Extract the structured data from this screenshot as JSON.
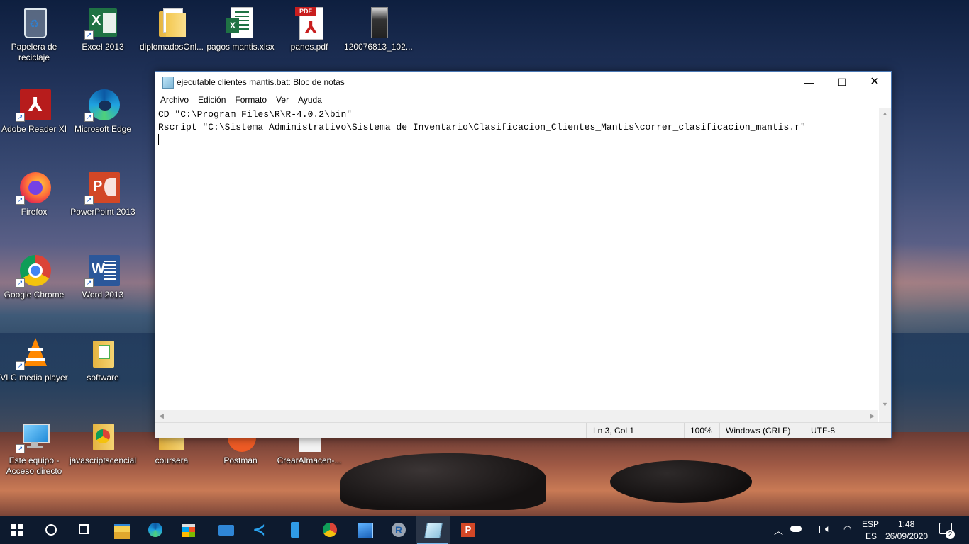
{
  "desktop": {
    "icons": [
      {
        "label": "Papelera de reciclaje",
        "icon": "recycle-bin-icon"
      },
      {
        "label": "Excel 2013",
        "icon": "excel-icon"
      },
      {
        "label": "diplomadosOnl...",
        "icon": "folder-icon"
      },
      {
        "label": "pagos mantis.xlsx",
        "icon": "excel-file-icon"
      },
      {
        "label": "panes.pdf",
        "icon": "pdf-file-icon"
      },
      {
        "label": "120076813_102...",
        "icon": "photo-file-icon"
      },
      {
        "label": "Adobe Reader XI",
        "icon": "adobe-reader-icon"
      },
      {
        "label": "Microsoft Edge",
        "icon": "edge-icon"
      },
      {
        "label": "Firefox",
        "icon": "firefox-icon"
      },
      {
        "label": "PowerPoint 2013",
        "icon": "powerpoint-icon"
      },
      {
        "label": "Google Chrome",
        "icon": "chrome-icon"
      },
      {
        "label": "Word 2013",
        "icon": "word-icon"
      },
      {
        "label": "VLC media player",
        "icon": "vlc-icon"
      },
      {
        "label": "software",
        "icon": "folder-icon"
      },
      {
        "label": "Este equipo - Acceso directo",
        "icon": "this-pc-icon"
      },
      {
        "label": "javascriptscencial",
        "icon": "chrome-folder-icon"
      },
      {
        "label": "coursera",
        "icon": "folder-icon"
      },
      {
        "label": "Postman",
        "icon": "postman-icon"
      },
      {
        "label": "CrearAlmacen-...",
        "icon": "file-icon"
      }
    ]
  },
  "window": {
    "title": "ejecutable clientes mantis.bat: Bloc de notas",
    "menu": [
      "Archivo",
      "Edición",
      "Formato",
      "Ver",
      "Ayuda"
    ],
    "content_lines": [
      "CD \"C:\\Program Files\\R\\R-4.0.2\\bin\"",
      "Rscript \"C:\\Sistema Administrativo\\Sistema de Inventario\\Clasificacion_Clientes_Mantis\\correr_clasificacion_mantis.r\"",
      ""
    ],
    "status": {
      "position": "Ln 3, Col 1",
      "zoom": "100%",
      "line_endings": "Windows (CRLF)",
      "encoding": "UTF-8"
    }
  },
  "taskbar": {
    "apps": [
      "start-icon",
      "search-icon",
      "task-view-icon",
      "file-explorer-icon",
      "edge-icon",
      "store-icon",
      "mail-icon",
      "vscode-icon",
      "phone-icon",
      "chrome-icon",
      "photos-icon",
      "r-icon",
      "notepad-icon",
      "powerpoint-icon"
    ],
    "lang_top": "ESP",
    "lang_bottom": "ES",
    "time": "1:48",
    "date": "26/09/2020",
    "notifications": "2"
  }
}
